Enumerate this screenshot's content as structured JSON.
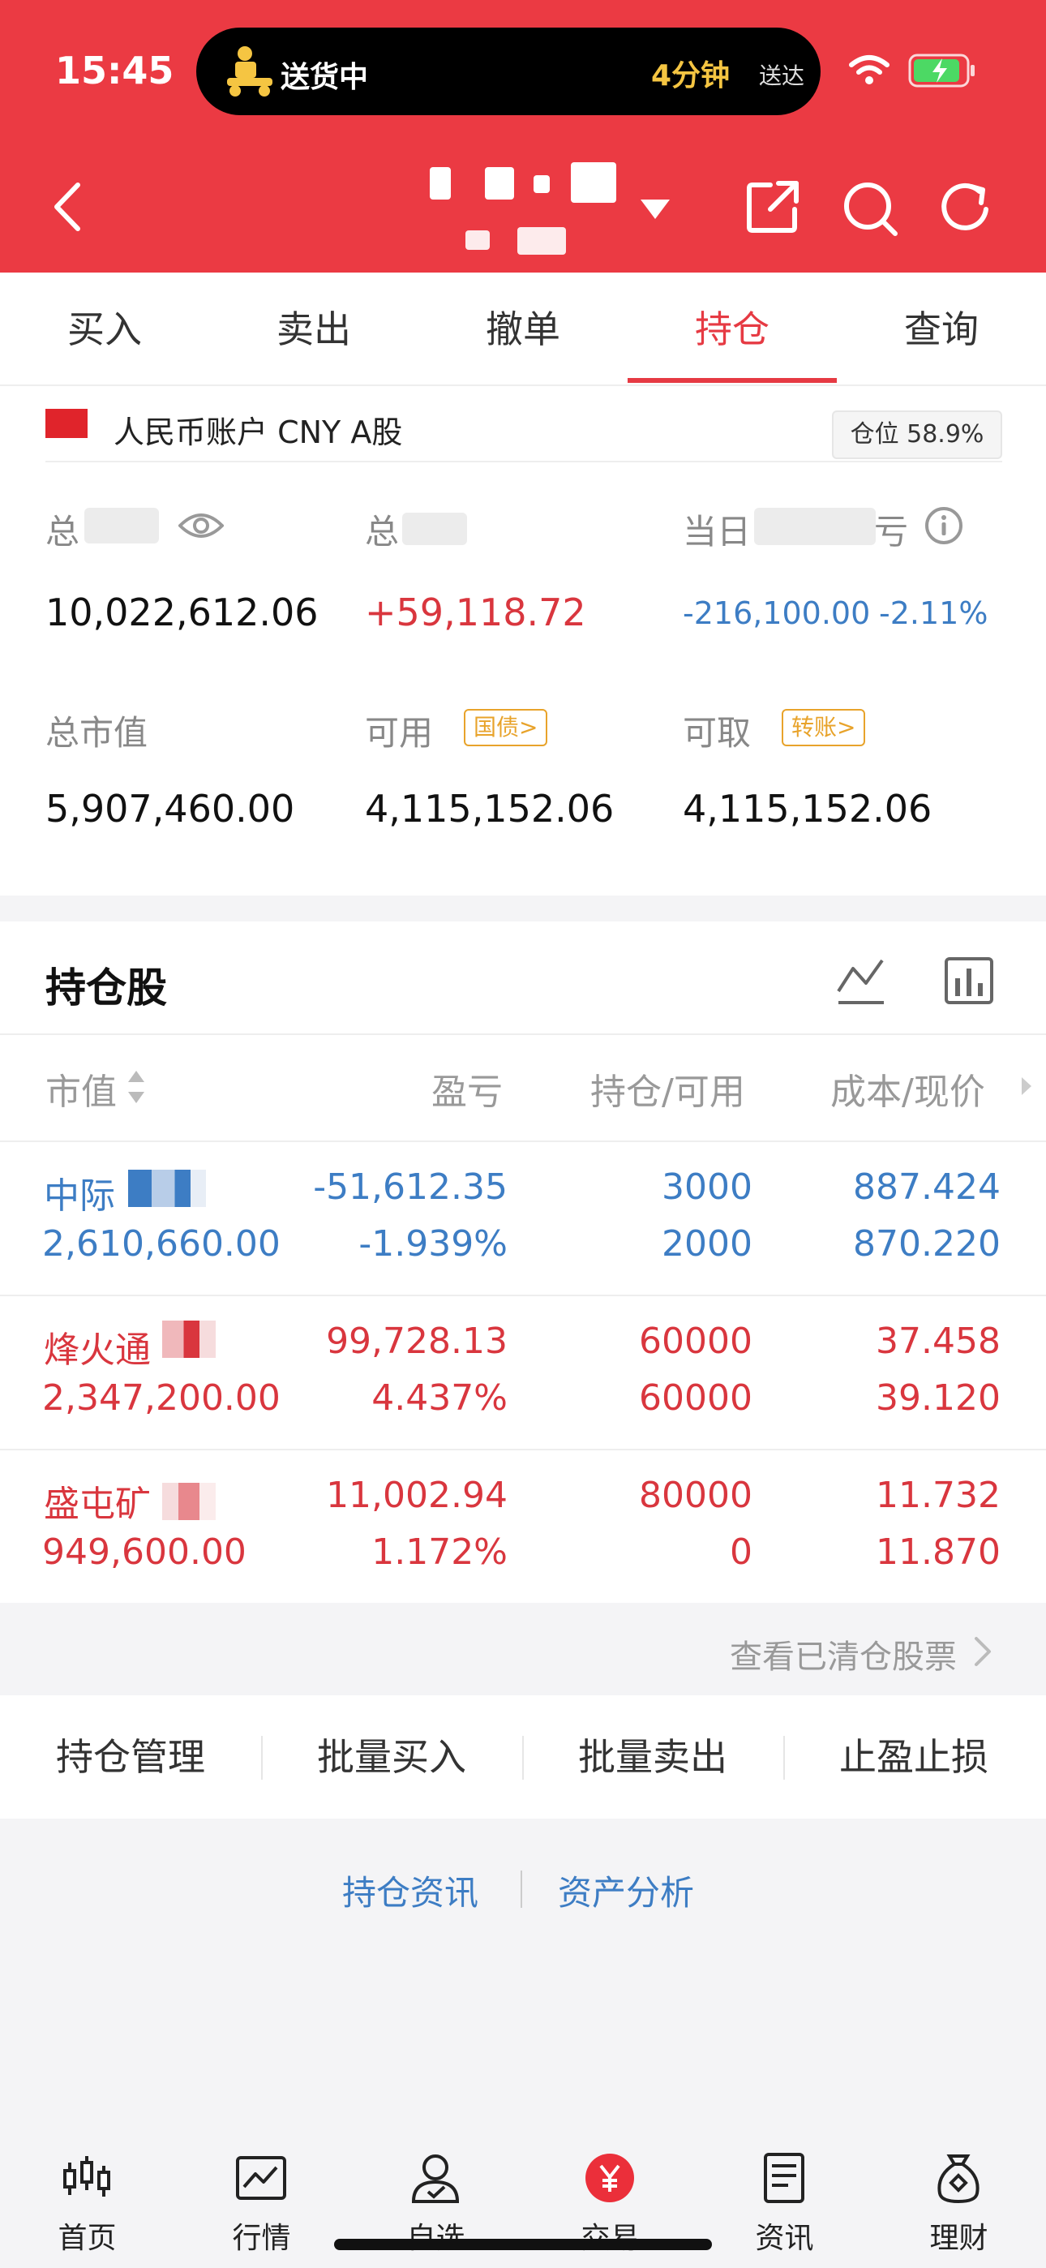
{
  "status_bar": {
    "time": "15:45",
    "island_status": "送货中",
    "island_eta": "4分钟",
    "island_eta_suffix": "送达"
  },
  "tabs": [
    {
      "label": "买入"
    },
    {
      "label": "卖出"
    },
    {
      "label": "撤单"
    },
    {
      "label": "持仓",
      "active": true
    },
    {
      "label": "查询"
    }
  ],
  "account": {
    "label": "人民币账户 CNY A股",
    "position_ratio": "仓位 58.9%",
    "total_assets_label": "总",
    "total_assets": "10,022,612.06",
    "total_pnl_label": "总",
    "total_pnl": "+59,118.72",
    "daily_pnl_label": "当日",
    "daily_pnl_label_suffix": "亏",
    "daily_pnl": "-216,100.00",
    "daily_pnl_pct": "-2.11%",
    "market_value_label": "总市值",
    "market_value": "5,907,460.00",
    "available_label": "可用",
    "available_tag": "国债>",
    "available": "4,115,152.06",
    "withdrawable_label": "可取",
    "withdrawable_tag": "转账>",
    "withdrawable": "4,115,152.06"
  },
  "holdings": {
    "title": "持仓股",
    "columns": [
      "市值",
      "盈亏",
      "持仓/可用",
      "成本/现价"
    ],
    "rows": [
      {
        "name": "中际",
        "market_value": "2,610,660.00",
        "pnl": "-51,612.35",
        "pnl_pct": "-1.939%",
        "hold": "3000",
        "avail": "2000",
        "cost": "887.424",
        "price": "870.220",
        "color": "#3d7dc4"
      },
      {
        "name": "烽火通",
        "market_value": "2,347,200.00",
        "pnl": "99,728.13",
        "pnl_pct": "4.437%",
        "hold": "60000",
        "avail": "60000",
        "cost": "37.458",
        "price": "39.120",
        "color": "#d9363e"
      },
      {
        "name": "盛屯矿",
        "market_value": "949,600.00",
        "pnl": "11,002.94",
        "pnl_pct": "1.172%",
        "hold": "80000",
        "avail": "0",
        "cost": "11.732",
        "price": "11.870",
        "color": "#d9363e"
      }
    ]
  },
  "cleared_link": "查看已清仓股票",
  "actions": [
    "持仓管理",
    "批量买入",
    "批量卖出",
    "止盈止损"
  ],
  "links": [
    "持仓资讯",
    "资产分析"
  ],
  "bottom_nav": [
    {
      "label": "首页",
      "icon": "candlestick-icon"
    },
    {
      "label": "行情",
      "icon": "market-chart-icon"
    },
    {
      "label": "自选",
      "icon": "watchlist-user-icon"
    },
    {
      "label": "交易",
      "icon": "trade-yuan-icon",
      "active": true
    },
    {
      "label": "资讯",
      "icon": "news-document-icon"
    },
    {
      "label": "理财",
      "icon": "wealth-bag-icon"
    }
  ]
}
